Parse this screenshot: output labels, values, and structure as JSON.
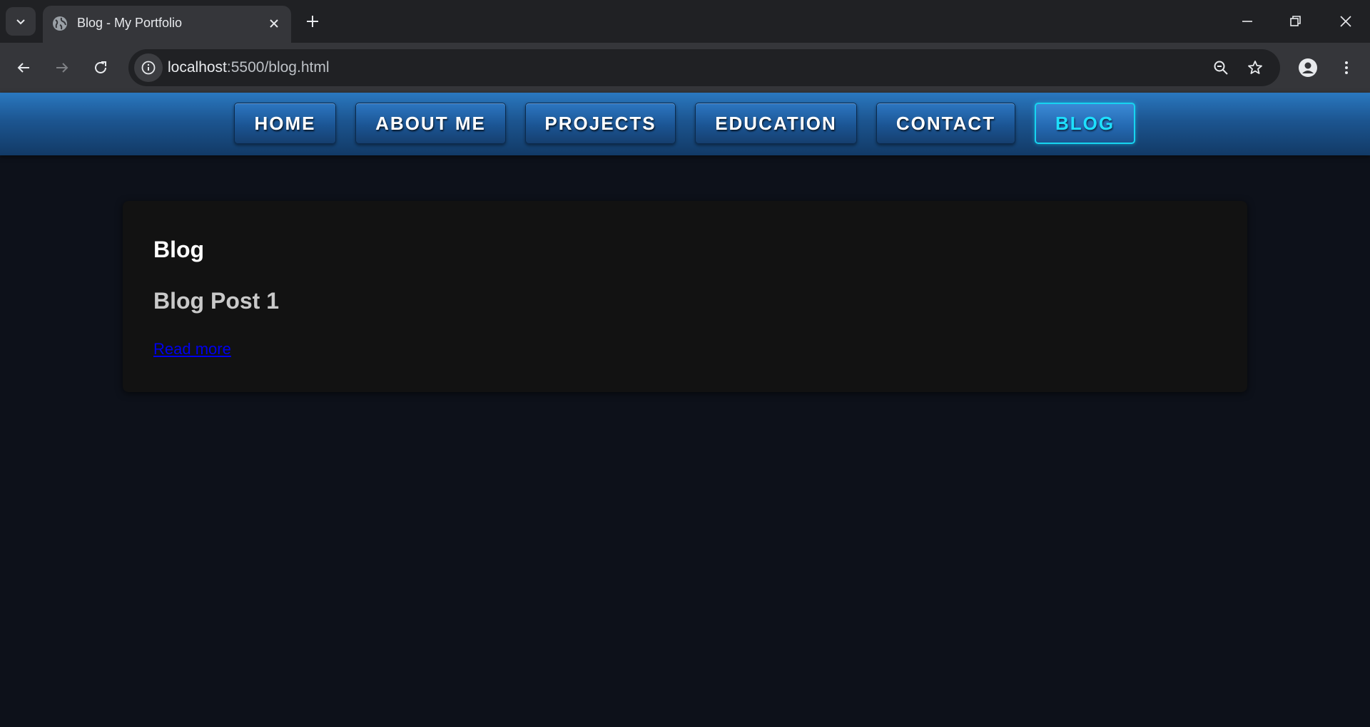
{
  "browser": {
    "tab_title": "Blog - My Portfolio",
    "url_host": "localhost",
    "url_rest": ":5500/blog.html"
  },
  "nav": {
    "items": [
      {
        "label": "HOME"
      },
      {
        "label": "ABOUT ME"
      },
      {
        "label": "PROJECTS"
      },
      {
        "label": "EDUCATION"
      },
      {
        "label": "CONTACT"
      },
      {
        "label": "BLOG",
        "active": true
      }
    ]
  },
  "content": {
    "heading": "Blog",
    "post_title": "Blog Post 1",
    "read_more": "Read more"
  },
  "colors": {
    "page_bg": "#0d111a",
    "nav_blue": "#1c5590",
    "active_accent": "#17d4f0",
    "card_bg": "#121212",
    "link": "#0000ee"
  }
}
